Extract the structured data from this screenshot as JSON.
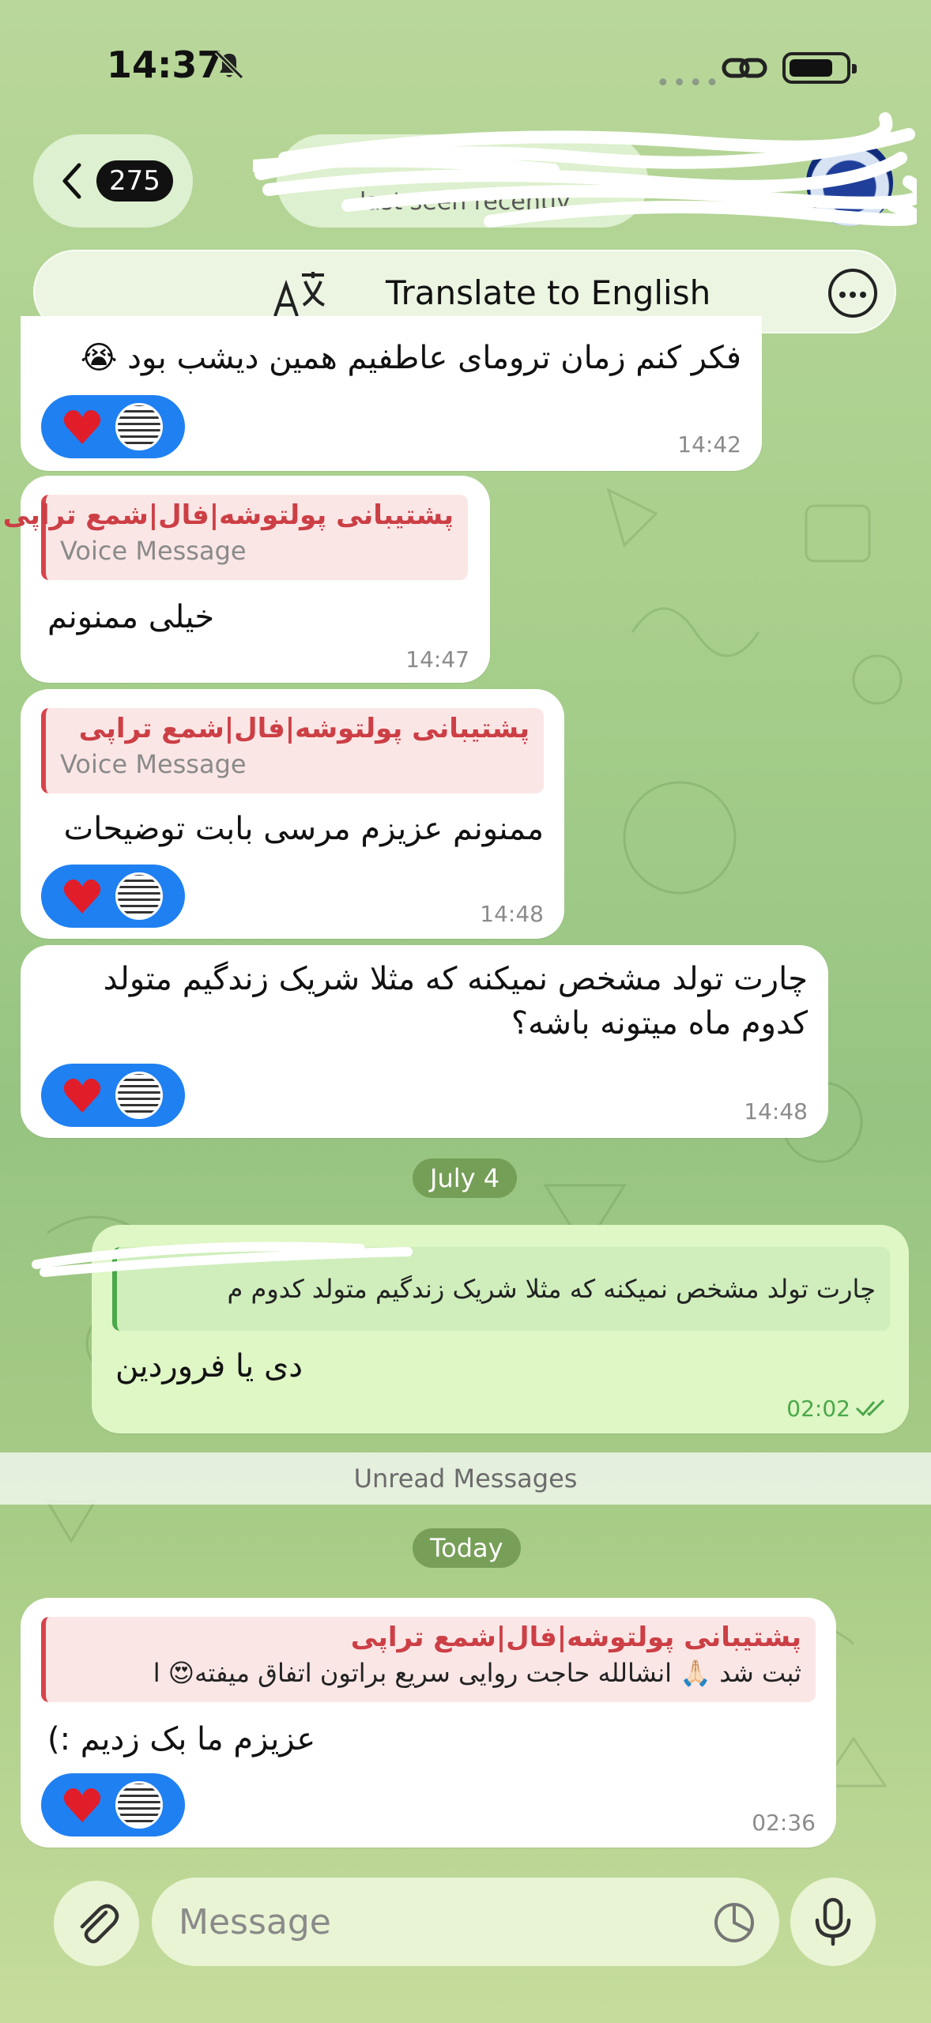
{
  "status_bar": {
    "time": "14:37",
    "signal_dots": "••••"
  },
  "header": {
    "unread_count": "275",
    "last_seen": "last seen recently",
    "translate_label": "Translate to English"
  },
  "messages": [
    {
      "text": "فکر کنم زمان ترومای عاطفیم همین دیشب بود 😭",
      "time": "14:42"
    },
    {
      "reply_name": "پشتیبانی پولتوشه|فال|شمع تراپی",
      "reply_sub": "Voice Message",
      "text": "خیلی ممنونم",
      "time": "14:47"
    },
    {
      "reply_name": "پشتیبانی پولتوشه|فال|شمع تراپی",
      "reply_sub": "Voice Message",
      "text": "ممنونم عزیزم مرسی بابت توضیحات",
      "time": "14:48"
    },
    {
      "text_line1": "چارت تولد مشخص نمیکنه که مثلا شریک زندگیم متولد",
      "text_line2": "کدوم ماه میتونه باشه؟",
      "time": "14:48"
    },
    {
      "reply_text": "چارت تولد مشخص نمیکنه که مثلا شریک زندگیم متولد کدوم م",
      "text": "دی یا فروردین",
      "time": "02:02"
    },
    {
      "reply_name": "پشتیبانی پولتوشه|فال|شمع تراپی",
      "reply_text": "ثبت شد 🙏🏻 انشالله حاجت روایی سریع براتون اتفاق میفته😍 ا",
      "text": "عزیزم ما بک زدیم :)",
      "time": "02:36"
    }
  ],
  "dividers": {
    "date_1": "July 4",
    "unread": "Unread Messages",
    "date_2": "Today"
  },
  "composer": {
    "placeholder": "Message"
  },
  "colors": {
    "reaction_bg": "#1f80f2",
    "reply_name": "#cc3f45",
    "outgoing_bg": "#dff6c5"
  }
}
